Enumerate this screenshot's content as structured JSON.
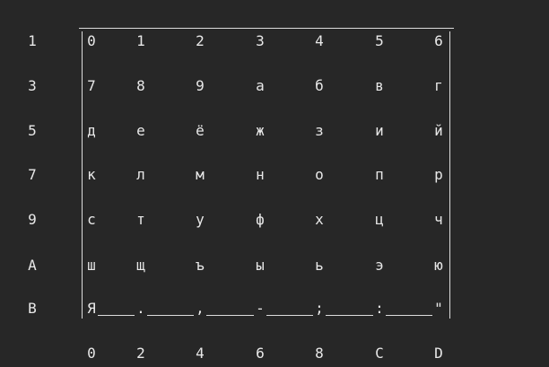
{
  "terminal": {
    "row_labels": [
      "1",
      "3",
      "5",
      "7",
      "9",
      "A",
      "B"
    ],
    "col_labels": [
      "0",
      "2",
      "4",
      "6",
      "8",
      "C",
      "D"
    ],
    "grid": [
      [
        "0",
        "1",
        "2",
        "3",
        "4",
        "5",
        "6"
      ],
      [
        "7",
        "8",
        "9",
        "а",
        "б",
        "в",
        "г"
      ],
      [
        "д",
        "е",
        "ё",
        "ж",
        "з",
        "и",
        "й"
      ],
      [
        "к",
        "л",
        "м",
        "н",
        "о",
        "п",
        "р"
      ],
      [
        "с",
        "т",
        "у",
        "ф",
        "х",
        "ц",
        "ч"
      ],
      [
        "ш",
        "щ",
        "ъ",
        "ы",
        "ь",
        "э",
        "ю"
      ],
      [
        "Я",
        ".",
        ",",
        "-",
        ";",
        ":",
        "\""
      ]
    ],
    "colors": {
      "background": "#272727",
      "foreground": "#e8e8e8",
      "border": "#dcdcdc"
    }
  }
}
